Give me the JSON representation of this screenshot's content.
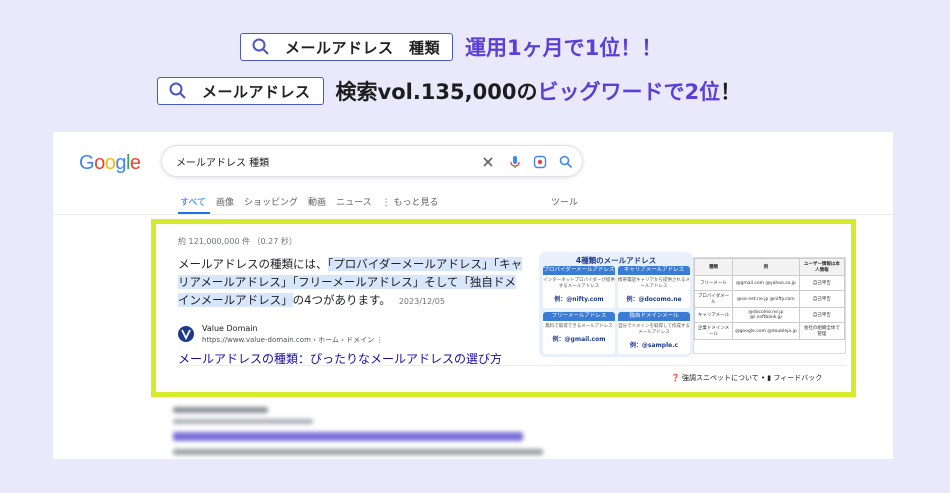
{
  "headline1": {
    "keyword": "メールアドレス　種類",
    "text": "運用1ヶ月で1位！！"
  },
  "headline2": {
    "keyword": "メールアドレス",
    "text_part1": "検索vol.135,000の",
    "text_part2": "ビッグワード",
    "text_part3": "で2位",
    "text_part4": "！"
  },
  "google": {
    "logo": "Google",
    "query": "メールアドレス 種類",
    "tabs": [
      "すべて",
      "画像",
      "ショッピング",
      "動画",
      "ニュース",
      "⋮ もっと見る"
    ],
    "tools": "ツール",
    "result_count": "約 121,000,000 件 （0.27 秒）",
    "answer_plain": "メールアドレスの種類には、",
    "answer_hl1": "「プロバイダーメールアドレス」「キャリアメールアドレス」「フリーメールアドレス」そして「独自ドメインメールアドレス」",
    "answer_tail": "の4つがあります。",
    "date": "2023/12/05",
    "source_name": "Value Domain",
    "source_url": "https://www.value-domain.com › ホーム › ドメイン ⋮",
    "result_title": "メールアドレスの種類：ぴったりなメールアドレスの選び方",
    "feedback": "❓ 強調スニペットについて  •  ▮ フィードバック",
    "image1": {
      "title": "4種類のメールアドレス",
      "cards": [
        {
          "head": "プロバイダーメールアドレス",
          "desc": "インターネットプロバイダーが提供するメールアドレス",
          "example": "例：@nifty.com"
        },
        {
          "head": "キャリアメールアドレス",
          "desc": "携帯電話キャリアから提供されるメールアドレス",
          "example": "例：@docomo.ne"
        },
        {
          "head": "フリーメールアドレス",
          "desc": "無料で取得できるメールアドレス",
          "example": "例：@gmail.com"
        },
        {
          "head": "独自ドメインメール",
          "desc": "自分でドメインを取得して作成するメールアドレス",
          "example": "例：@sample.c"
        }
      ]
    },
    "image2": {
      "headers": [
        "種類",
        "例",
        "ユーザー情報は本人情報"
      ],
      "rows": [
        [
          "フリーメール",
          "@gmail.com @yahoo.co.jp",
          "自己申告"
        ],
        [
          "プロバイダメール",
          "@so-net.ne.jp @nifty.com",
          "自己申告"
        ],
        [
          "キャリアメール",
          "@docomo.ne.jp @i.softbank.jp",
          "自己申告"
        ],
        [
          "企業ドメインメール",
          "@google.com @doubleja.jp",
          "会社の組織全体で管理"
        ]
      ]
    }
  },
  "colors": {
    "accent_purple": "#5b3fd6",
    "highlight_border": "#d6ea2a",
    "link_blue": "#1a0dab"
  }
}
